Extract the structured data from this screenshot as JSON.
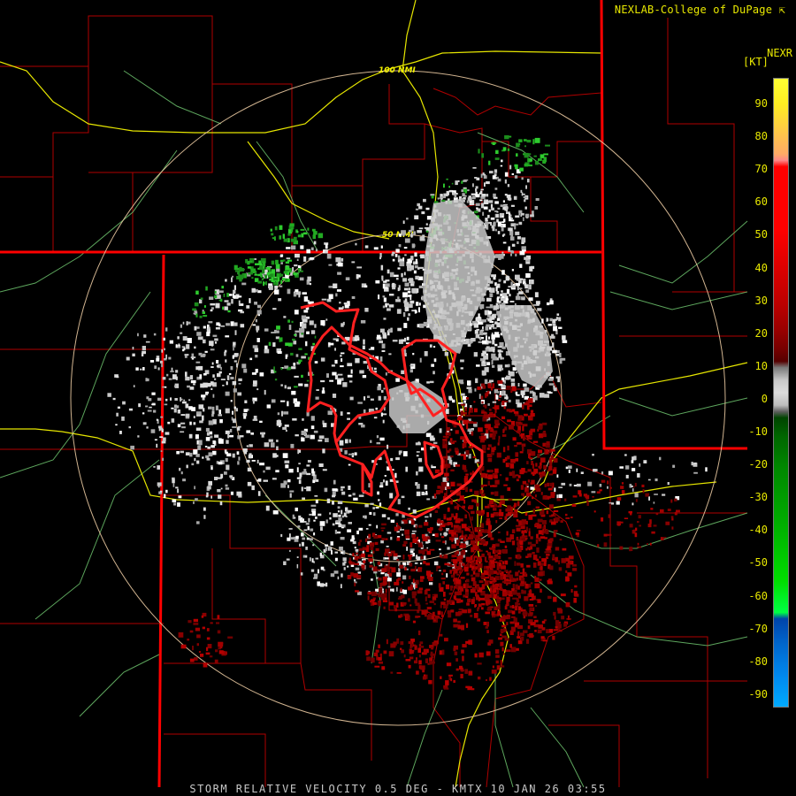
{
  "credit": "NEXLAB-College of DuPage",
  "credit_icon": "cursor-arrow-icon",
  "product": "NEXR",
  "unit": "[KT]",
  "footer": "STORM RELATIVE VELOCITY 0.5 DEG - KMTX 10 JAN 26 03:55",
  "range_rings": [
    {
      "label": "50 NMI"
    },
    {
      "label": "100 NMI"
    }
  ],
  "colorbar": {
    "ticks": [
      "90",
      "80",
      "70",
      "60",
      "50",
      "40",
      "30",
      "20",
      "10",
      "0",
      "-10",
      "-20",
      "-30",
      "-40",
      "-50",
      "-60",
      "-70",
      "-80",
      "-90"
    ]
  },
  "colors": {
    "text": "#e8e800",
    "state_border": "#ff0000",
    "county_line": "#b00000",
    "highway": "#e6e600",
    "road": "#78c878",
    "range_ring": "#e8c8a0",
    "warning_polygon": "#ff2020",
    "inbound_green": "#22aa22",
    "outbound_red": "#a00000",
    "rf_gray": "#c0c0c0"
  }
}
